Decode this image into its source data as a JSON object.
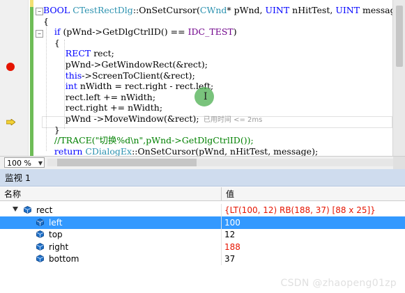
{
  "editor": {
    "lines": [
      {
        "id": "l1",
        "parts": [
          {
            "t": "BOOL ",
            "c": "kw"
          },
          {
            "t": "CTestRectDlg",
            "c": "cls"
          },
          {
            "t": "::OnSetCursor(",
            "c": ""
          },
          {
            "t": "CWnd",
            "c": "cls"
          },
          {
            "t": "* pWnd, ",
            "c": ""
          },
          {
            "t": "UINT",
            "c": "kw"
          },
          {
            "t": " nHitTest, ",
            "c": ""
          },
          {
            "t": "UINT",
            "c": "kw"
          },
          {
            "t": " message)",
            "c": ""
          }
        ]
      },
      {
        "id": "l2",
        "parts": [
          {
            "t": "{",
            "c": ""
          }
        ]
      },
      {
        "id": "l3",
        "parts": [
          {
            "t": "    if",
            "c": "kw"
          },
          {
            "t": " (pWnd->GetDlgCtrlID() == ",
            "c": ""
          },
          {
            "t": "IDC_TEST",
            "c": "mac"
          },
          {
            "t": ")",
            "c": ""
          }
        ]
      },
      {
        "id": "l4",
        "parts": [
          {
            "t": "    {",
            "c": ""
          }
        ]
      },
      {
        "id": "l5",
        "parts": [
          {
            "t": "        RECT",
            "c": "kw"
          },
          {
            "t": " rect;",
            "c": ""
          }
        ]
      },
      {
        "id": "l6",
        "parts": [
          {
            "t": "        pWnd->GetWindowRect(&rect);",
            "c": ""
          }
        ]
      },
      {
        "id": "l7",
        "parts": [
          {
            "t": "        this",
            "c": "kw"
          },
          {
            "t": "->ScreenToClient(&rect);",
            "c": ""
          }
        ]
      },
      {
        "id": "l8",
        "parts": [
          {
            "t": "        int",
            "c": "kw"
          },
          {
            "t": " nWidth = rect.right - rect.left;",
            "c": ""
          }
        ]
      },
      {
        "id": "l9",
        "parts": [
          {
            "t": "        rect.left += nWidth;",
            "c": ""
          }
        ]
      },
      {
        "id": "l10",
        "parts": [
          {
            "t": "        rect.right += nWidth;",
            "c": ""
          }
        ]
      },
      {
        "id": "l11",
        "parts": [
          {
            "t": "        pWnd ->MoveWindow(&rect);",
            "c": ""
          }
        ]
      },
      {
        "id": "l12",
        "parts": [
          {
            "t": "    }",
            "c": ""
          }
        ]
      },
      {
        "id": "l13",
        "parts": [
          {
            "t": "    //TRACE(\"切换%d\\n\",pWnd->GetDlgCtrlID());",
            "c": "cmt"
          }
        ]
      },
      {
        "id": "l14",
        "parts": [
          {
            "t": "    return ",
            "c": "kw"
          },
          {
            "t": "CDialogEx",
            "c": "cls"
          },
          {
            "t": "::OnSetCursor(pWnd, nHitTest, message);",
            "c": ""
          }
        ]
      }
    ],
    "elapsed_label": "已用时间 <= 2ms"
  },
  "zoom": {
    "value": "100 %"
  },
  "watch": {
    "title": "监视 1",
    "col_name": "名称",
    "col_value": "值",
    "rows": [
      {
        "name": "rect",
        "value": "{LT(100, 12) RB(188, 37)  [88 x 25]}",
        "value_color": "#e51400",
        "expanded": true,
        "selected": false
      },
      {
        "name": "left",
        "value": "100",
        "value_color": "#000000",
        "selected": true
      },
      {
        "name": "top",
        "value": "12",
        "value_color": "#000000",
        "selected": false
      },
      {
        "name": "right",
        "value": "188",
        "value_color": "#e51400",
        "selected": false
      },
      {
        "name": "bottom",
        "value": "37",
        "value_color": "#000000",
        "selected": false
      }
    ]
  },
  "watermark": "CSDN @zhaopeng01zp",
  "colors": {
    "accent_selected": "#3399ff",
    "changed_value": "#e51400",
    "breakpoint": "#e51400",
    "change_bar": "#6ebc57"
  }
}
